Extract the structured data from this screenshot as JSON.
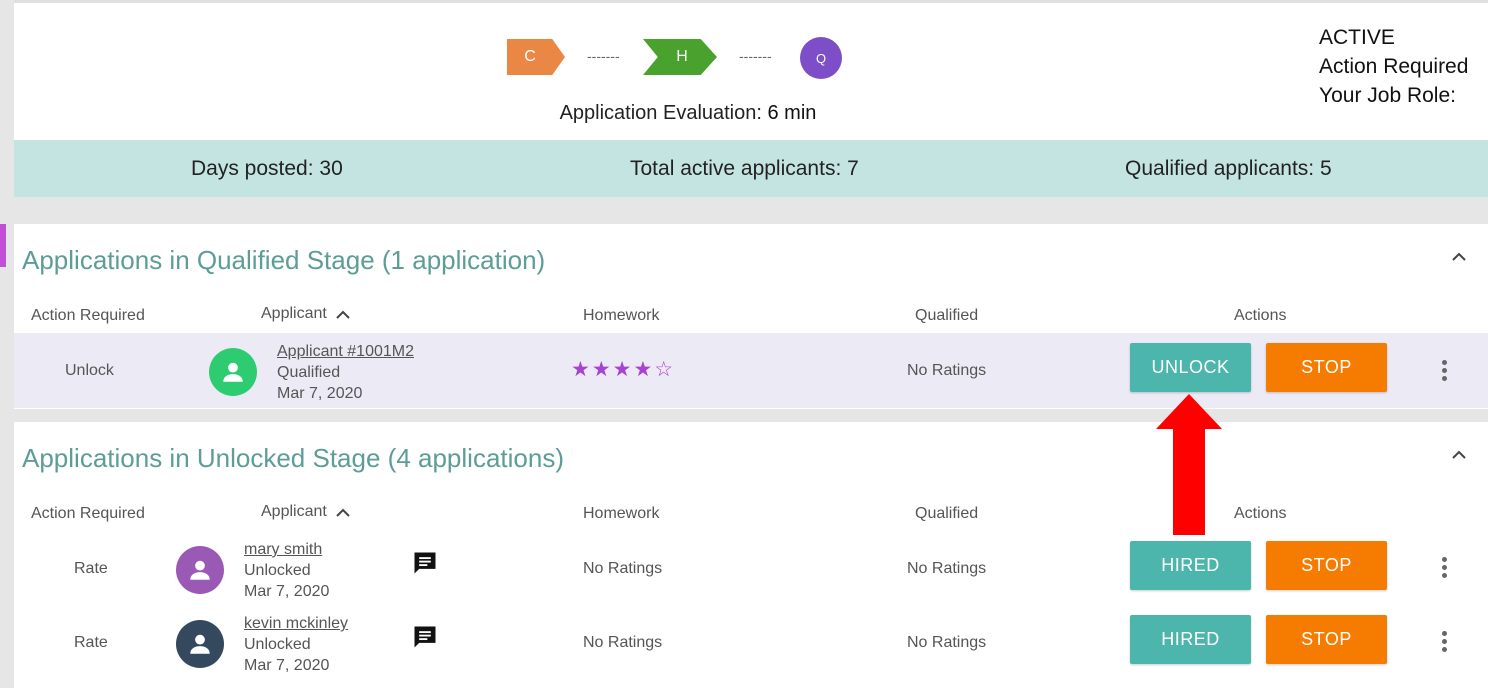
{
  "stage_flow": {
    "c_label": "C",
    "h_label": "H",
    "q_label": "Q",
    "connector": "-------",
    "colors": {
      "c": "#eb8744",
      "h": "#4aa22e",
      "q": "#7e4ec9"
    }
  },
  "evaluation": {
    "label": "Application Evaluation:",
    "value": "6 min"
  },
  "status": {
    "state": "ACTIVE",
    "action": "Action Required",
    "role": "Your Job Role:"
  },
  "stats": {
    "days_posted": "Days posted: 30",
    "total_active": "Total active applicants: 7",
    "qualified": "Qualified applicants: 5"
  },
  "qualified_section": {
    "title": "Applications in Qualified Stage (1 application)",
    "columns": {
      "action_required": "Action Required",
      "applicant": "Applicant",
      "homework": "Homework",
      "qualified": "Qualified",
      "actions": "Actions"
    },
    "rows": [
      {
        "action": "Unlock",
        "name": "Applicant #1001M2",
        "stage": "Qualified",
        "date": "Mar 7, 2020",
        "homework_stars": "★★★★☆",
        "homework_rating": 4,
        "qualified": "No Ratings",
        "primary_button": "UNLOCK",
        "secondary_button": "STOP",
        "avatar_color": "#2ecc71"
      }
    ]
  },
  "unlocked_section": {
    "title": "Applications in Unlocked Stage (4 applications)",
    "columns": {
      "action_required": "Action Required",
      "applicant": "Applicant",
      "homework": "Homework",
      "qualified": "Qualified",
      "actions": "Actions"
    },
    "rows": [
      {
        "action": "Rate",
        "name": "mary smith",
        "stage": "Unlocked",
        "date": "Mar 7, 2020",
        "homework": "No Ratings",
        "qualified": "No Ratings",
        "primary_button": "HIRED",
        "secondary_button": "STOP",
        "avatar_color": "#9b59b6"
      },
      {
        "action": "Rate",
        "name": "kevin mckinley",
        "stage": "Unlocked",
        "date": "Mar 7, 2020",
        "homework": "No Ratings",
        "qualified": "No Ratings",
        "primary_button": "HIRED",
        "secondary_button": "STOP",
        "avatar_color": "#34495e"
      }
    ]
  },
  "accent_colors": {
    "teal": "#4db6ac",
    "orange": "#f57c00",
    "title": "#5d9d97",
    "stats_bg": "#c4e4e2",
    "annotation_arrow": "#ff0000"
  }
}
